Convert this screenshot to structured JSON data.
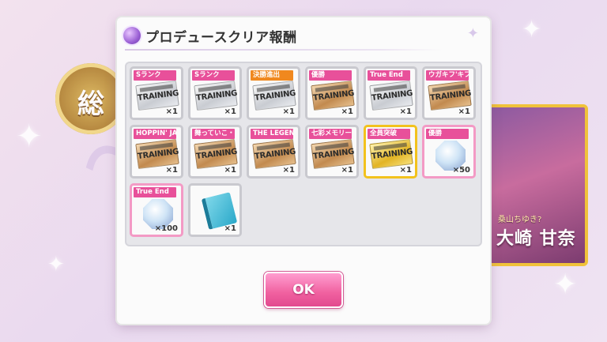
{
  "dialog": {
    "title": "プロデュースクリア報酬",
    "ok_label": "OK"
  },
  "background": {
    "badge_char": "総",
    "card_subtitle": "桑山ちゆき?",
    "card_name": "大崎 甘奈"
  },
  "rewards": [
    {
      "label": "Sランク",
      "item": "TRAINING",
      "qty": "×1"
    },
    {
      "label": "Sランク",
      "item": "TRAINING",
      "qty": "×1"
    },
    {
      "label": "決勝進出",
      "item": "TRAINING",
      "qty": "×1"
    },
    {
      "label": "優勝",
      "item": "TRAINING",
      "qty": "×1"
    },
    {
      "label": "True End",
      "item": "TRAINING",
      "qty": "×1"
    },
    {
      "label": "ウガキフ'キフ'-・・・",
      "item": "TRAINING",
      "qty": "×1"
    },
    {
      "label": "HOPPIN' JAM",
      "item": "TRAINING",
      "qty": "×1"
    },
    {
      "label": "舞っていこ・・・",
      "item": "TRAINING",
      "qty": "×1"
    },
    {
      "label": "THE LEGEND",
      "item": "TRAINING",
      "qty": "×1"
    },
    {
      "label": "七彩メモリーズ",
      "item": "TRAINING",
      "qty": "×1"
    },
    {
      "label": "全員突破",
      "item": "TRAINING",
      "qty": "×1"
    },
    {
      "label": "優勝",
      "item": "gem",
      "qty": "×50"
    },
    {
      "label": "True End",
      "item": "gem",
      "qty": "×100"
    },
    {
      "label": "",
      "item": "notebook",
      "qty": "×1"
    }
  ],
  "colors": {
    "accent_pink": "#e8509a",
    "ok_button": "#f0609f",
    "gold_border": "#f2c21d"
  }
}
